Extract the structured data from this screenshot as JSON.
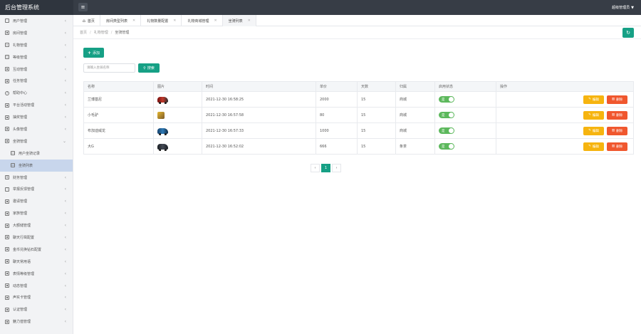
{
  "app": {
    "title": "后台管理系统",
    "user": "超级管理员"
  },
  "sidebar": {
    "items": [
      {
        "label": "用户管理",
        "icon": "users-icon",
        "sub": false,
        "active": false
      },
      {
        "label": "房间管理",
        "icon": "grid-icon",
        "sub": false,
        "active": false
      },
      {
        "label": "礼物管理",
        "icon": "gift-icon",
        "sub": false,
        "active": false
      },
      {
        "label": "等级管理",
        "icon": "diamond-icon",
        "sub": false,
        "active": false
      },
      {
        "label": "互动管理",
        "icon": "grid-icon",
        "sub": false,
        "active": false
      },
      {
        "label": "任务管理",
        "icon": "grid-icon",
        "sub": false,
        "active": false
      },
      {
        "label": "帮助中心",
        "icon": "help-icon",
        "sub": false,
        "active": false
      },
      {
        "label": "平台活动管理",
        "icon": "grid-icon",
        "sub": false,
        "active": false
      },
      {
        "label": "抽奖管理",
        "icon": "grid-icon",
        "sub": false,
        "active": false
      },
      {
        "label": "头像管理",
        "icon": "grid-icon",
        "sub": false,
        "active": false
      },
      {
        "label": "坐骑管理",
        "icon": "grid-icon",
        "sub": false,
        "active": false
      },
      {
        "label": "用户坐骑记录",
        "icon": "doc-icon",
        "sub": true,
        "active": false
      },
      {
        "label": "坐骑列表",
        "icon": "doc-icon",
        "sub": true,
        "active": true
      },
      {
        "label": "财务管理",
        "icon": "dollar-icon",
        "sub": false,
        "active": false
      },
      {
        "label": "举报反馈管理",
        "icon": "warning-icon",
        "sub": false,
        "active": false
      },
      {
        "label": "邀请管理",
        "icon": "grid-icon",
        "sub": false,
        "active": false
      },
      {
        "label": "家族管理",
        "icon": "grid-icon",
        "sub": false,
        "active": false
      },
      {
        "label": "大额储管理",
        "icon": "grid-icon",
        "sub": false,
        "active": false
      },
      {
        "label": "聊天行凿配置",
        "icon": "grid-icon",
        "sub": false,
        "active": false
      },
      {
        "label": "金币兑换钻石配置",
        "icon": "grid-icon",
        "sub": false,
        "active": false
      },
      {
        "label": "聊天常用语",
        "icon": "grid-icon",
        "sub": false,
        "active": false
      },
      {
        "label": "表情等级管理",
        "icon": "grid-icon",
        "sub": false,
        "active": false
      },
      {
        "label": "动态管理",
        "icon": "grid-icon",
        "sub": false,
        "active": false
      },
      {
        "label": "声实卡管理",
        "icon": "grid-icon",
        "sub": false,
        "active": false
      },
      {
        "label": "认证管理",
        "icon": "grid-icon",
        "sub": false,
        "active": false
      },
      {
        "label": "魅力值管理",
        "icon": "grid-icon",
        "sub": false,
        "active": false
      }
    ]
  },
  "tabs": [
    {
      "label": "首页",
      "home": true,
      "closable": false,
      "active": false
    },
    {
      "label": "房间类型列表",
      "home": false,
      "closable": true,
      "active": false
    },
    {
      "label": "礼物数量配置",
      "home": false,
      "closable": true,
      "active": false
    },
    {
      "label": "礼物商城管理",
      "home": false,
      "closable": true,
      "active": false
    },
    {
      "label": "坐骑列表",
      "home": false,
      "closable": true,
      "active": true
    }
  ],
  "breadcrumb": [
    "首页",
    "礼物管理",
    "坐骑管理"
  ],
  "toolbar": {
    "add_label": "添加",
    "search_placeholder": "请输入坐骑名称",
    "search_label": "搜索"
  },
  "table": {
    "headers": [
      "名称",
      "图片",
      "时间",
      "单价",
      "天数",
      "归属",
      "启用状态",
      "操作"
    ],
    "rows": [
      {
        "name": "兰博基尼",
        "image": "red-sports-car",
        "time": "2021-12-30 16:58:25",
        "price": "2000",
        "days": "15",
        "owner": "商城",
        "status": "是"
      },
      {
        "name": "小毛驴",
        "image": "donkey-toy",
        "time": "2021-12-30 16:57:58",
        "price": "80",
        "days": "15",
        "owner": "商城",
        "status": "是"
      },
      {
        "name": "布加迪威龙",
        "image": "blue-sports-car",
        "time": "2021-12-30 16:57:33",
        "price": "1000",
        "days": "15",
        "owner": "商城",
        "status": "是"
      },
      {
        "name": "大G",
        "image": "dark-suv",
        "time": "2021-12-30 16:52:02",
        "price": "666",
        "days": "15",
        "owner": "条茶",
        "status": "是"
      }
    ],
    "edit_label": "编辑",
    "delete_label": "删除"
  },
  "pagination": {
    "current": "1"
  }
}
